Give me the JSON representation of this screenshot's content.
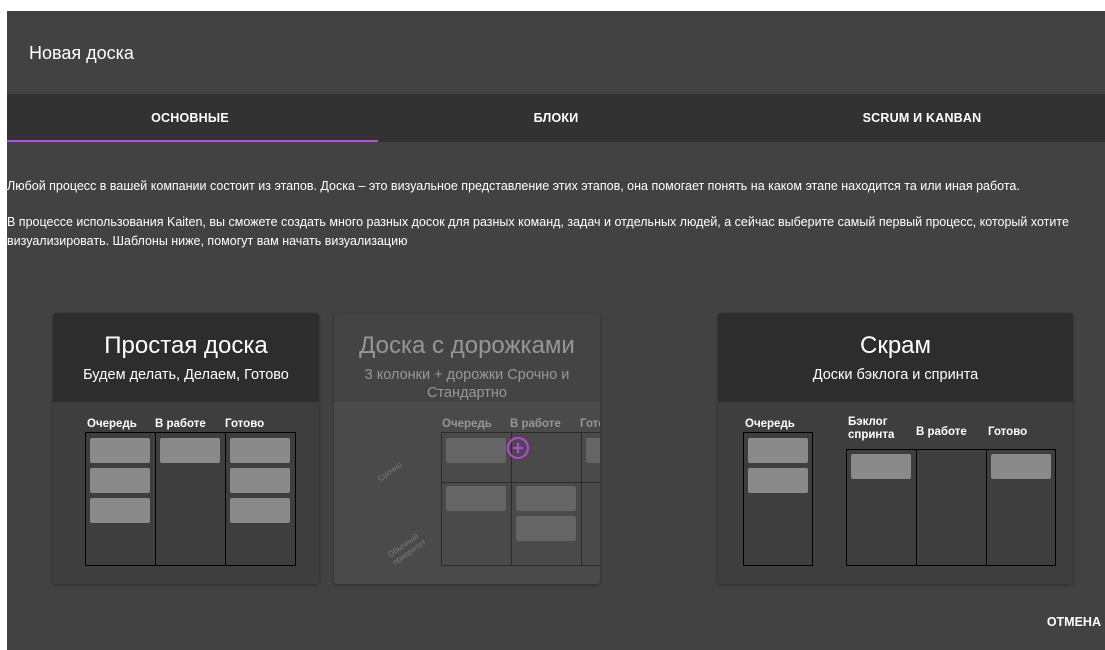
{
  "dialog": {
    "title": "Новая доска",
    "tabs": [
      {
        "label": "ОСНОВНЫЕ",
        "active": true
      },
      {
        "label": "БЛОКИ",
        "active": false
      },
      {
        "label": "SCRUM И KANBAN",
        "active": false
      }
    ],
    "intro": [
      "Любой процесс в вашей компании состоит из этапов. Доска – это визуальное представление этих этапов, она помогает понять на каком этапе находится та или иная работа.",
      "В процессе использования Kaiten, вы сможете создать много разных досок для разных команд, задач и отдельных людей, а сейчас выберите самый первый процесс, который хотите визуализировать. Шаблоны ниже, помогут вам начать визуализацию"
    ],
    "cards": [
      {
        "title": "Простая доска",
        "subtitle": "Будем делать, Делаем, Готово",
        "columns": [
          "Очередь",
          "В работе",
          "Готово"
        ]
      },
      {
        "title": "Доска с дорожками",
        "subtitle": "3 колонки + дорожки Срочно и Стандартно",
        "columns": [
          "Очередь",
          "В работе",
          "Готово"
        ],
        "lanes": [
          "Срочно",
          "Обычный приоритет"
        ]
      },
      {
        "title": "Скрам",
        "subtitle": "Доски бэклога и спринта",
        "columns": [
          "Очередь",
          "Бэклог спринта",
          "В работе",
          "Готово"
        ]
      }
    ],
    "cancel_label": "ОТМЕНА",
    "colors": {
      "background": "#424242",
      "tabs": "#323232",
      "accent": "#b44fe0",
      "chip": "#8a8a8a"
    },
    "icons": {
      "add": "plus-circle-icon"
    }
  }
}
